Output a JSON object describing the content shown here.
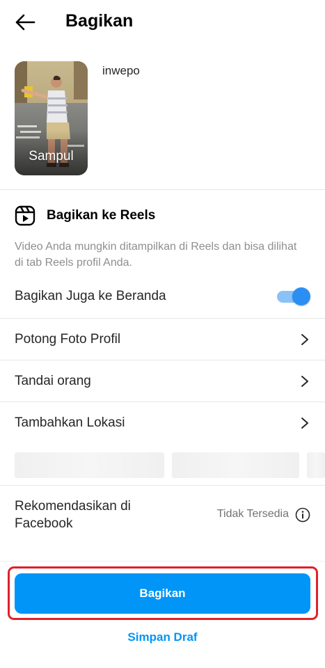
{
  "header": {
    "title": "Bagikan",
    "back_icon": "arrow-left-icon"
  },
  "post": {
    "cover_label": "Sampul",
    "username": "inwepo"
  },
  "reels": {
    "icon": "reels-icon",
    "title": "Bagikan ke Reels",
    "description": "Video Anda mungkin ditampilkan di Reels dan bisa dilihat di tab Reels profil Anda."
  },
  "feed_toggle": {
    "label": "Bagikan Juga ke Beranda",
    "on": true
  },
  "menu": [
    {
      "label": "Potong Foto Profil"
    },
    {
      "label": "Tandai orang"
    },
    {
      "label": "Tambahkan Lokasi"
    }
  ],
  "facebook": {
    "label": "Rekomendasikan di Facebook",
    "status": "Tidak Tersedia",
    "info_icon": "info-icon"
  },
  "actions": {
    "share_label": "Bagikan",
    "draft_label": "Simpan Draf"
  },
  "colors": {
    "accent": "#0095f6",
    "toggle_knob": "#2b8ef2",
    "highlight": "#e0202a"
  }
}
